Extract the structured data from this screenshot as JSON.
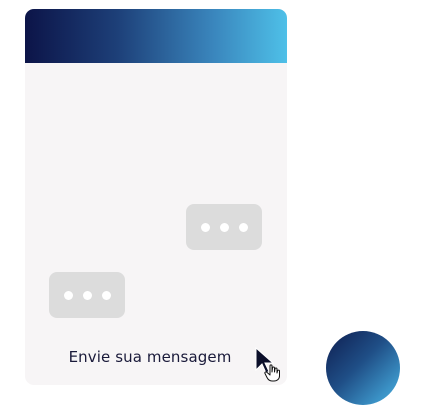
{
  "chat_window": {
    "header": {
      "gradient_colors": [
        "#0c1448",
        "#1d3f78",
        "#3a86bd",
        "#4ec0e8"
      ]
    },
    "typing_indicators": [
      {
        "side": "right",
        "dots": 3
      },
      {
        "side": "left",
        "dots": 3
      }
    ],
    "footer": {
      "send_message_label": "Envie sua mensagem"
    },
    "background_color": "#f7f5f6"
  },
  "launcher": {
    "gradient_colors": [
      "#0e1d4f",
      "#1f4e86",
      "#3a90c4",
      "#4ab0de"
    ]
  },
  "icons": {
    "cursor": "hand-pointer-cursor-icon"
  }
}
